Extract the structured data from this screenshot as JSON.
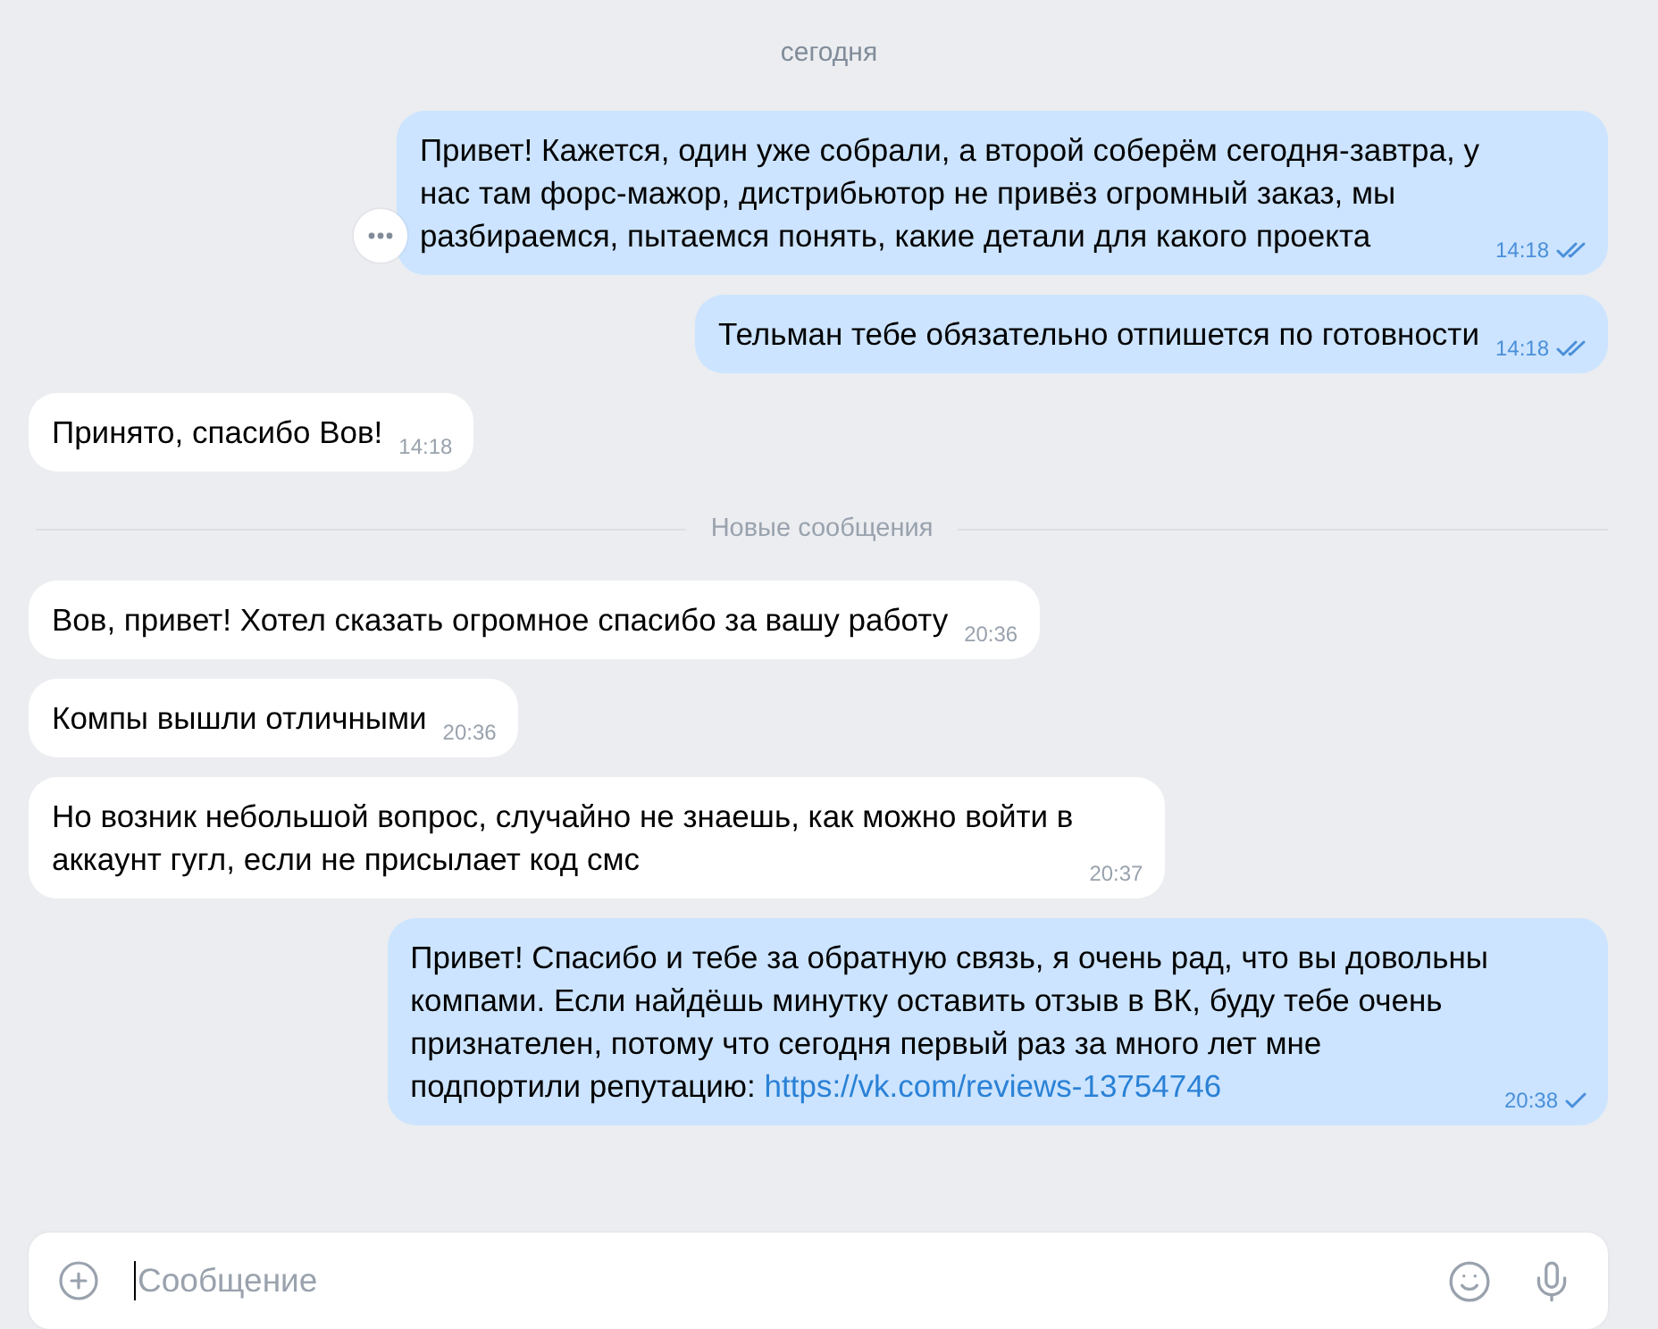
{
  "date_label": "сегодня",
  "messages": [
    {
      "kind": "outgoing",
      "lines": [
        "Привет! Кажется, один уже собрали, а второй соберём сегодня-завтра, у",
        "нас там форс-мажор, дистрибьютор не привёз огромный заказ, мы",
        "разбираемся, пытаемся понять, какие детали для какого проекта"
      ],
      "time": "14:18",
      "read": true,
      "hovered": true
    },
    {
      "kind": "outgoing",
      "lines": [
        "Тельман тебе обязательно отпишется по готовности"
      ],
      "time": "14:18",
      "read": true,
      "hovered": false
    },
    {
      "kind": "incoming",
      "lines": [
        "Принято, спасибо Вов!"
      ],
      "time": "14:18",
      "hovered": false
    },
    {
      "kind": "divider",
      "label": "Новые сообщения"
    },
    {
      "kind": "incoming",
      "lines": [
        "Вов, привет! Хотел сказать огромное спасибо за вашу работу"
      ],
      "time": "20:36",
      "hovered": false
    },
    {
      "kind": "incoming",
      "lines": [
        "Компы вышли отличными"
      ],
      "time": "20:36",
      "hovered": false
    },
    {
      "kind": "incoming",
      "lines": [
        "Но возник небольшой вопрос, случайно не знаешь, как можно войти в",
        "аккаунт гугл, если не присылает код смс"
      ],
      "time": "20:37",
      "hovered": false
    },
    {
      "kind": "outgoing",
      "lines": [
        "Привет! Спасибо и тебе за обратную связь, я очень рад, что вы довольны",
        "компами. Если найдёшь минутку оставить отзыв в ВК, буду тебе очень",
        "признателен, потому что сегодня первый раз за много лет мне",
        "подпортили репутацию:"
      ],
      "link": "https://vk.com/reviews-13754746",
      "time": "20:38",
      "read": false,
      "hovered": false
    }
  ],
  "composer": {
    "placeholder": "Сообщение",
    "focused": true
  }
}
